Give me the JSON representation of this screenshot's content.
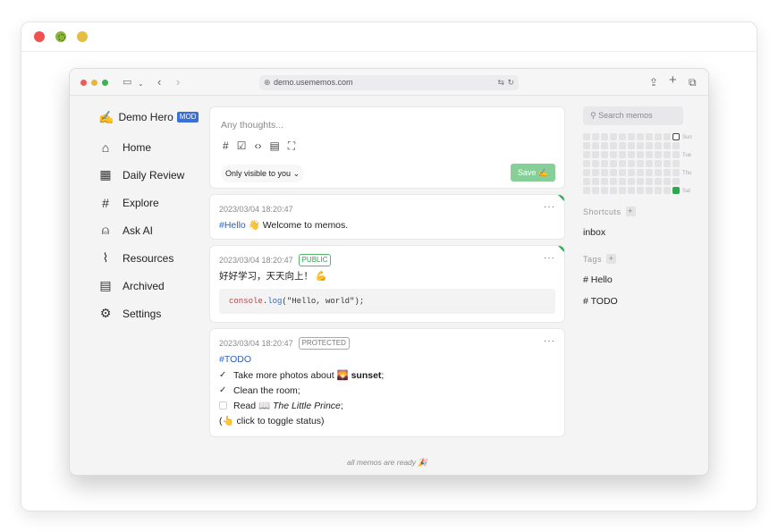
{
  "browser": {
    "url": "demo.usememos.com"
  },
  "sidebar": {
    "brand_emoji": "✍️",
    "brand_name": "Demo Hero",
    "badge": "MOD",
    "items": [
      {
        "label": "Home",
        "icon": "home-icon"
      },
      {
        "label": "Daily Review",
        "icon": "calendar-icon"
      },
      {
        "label": "Explore",
        "icon": "hash-icon"
      },
      {
        "label": "Ask AI",
        "icon": "bot-icon"
      },
      {
        "label": "Resources",
        "icon": "paperclip-icon"
      },
      {
        "label": "Archived",
        "icon": "archive-icon"
      },
      {
        "label": "Settings",
        "icon": "gear-icon"
      }
    ]
  },
  "editor": {
    "placeholder": "Any thoughts...",
    "visibility": "Only visible to you",
    "save_label": "Save ✍️"
  },
  "memos": [
    {
      "time": "2023/03/04 18:20:47",
      "tag": "#Hello",
      "text": "👋 Welcome to memos."
    },
    {
      "time": "2023/03/04 18:20:47",
      "visibility": "PUBLIC",
      "text": "好好学习，天天向上！ 💪",
      "code_obj": "console",
      "code_fn": "log",
      "code_args": "(\"Hello, world\");"
    },
    {
      "time": "2023/03/04 18:20:47",
      "visibility": "PROTECTED",
      "tag": "#TODO",
      "todo1": "Take more photos about 🌄 ",
      "todo1_bold": "sunset",
      "todo1_end": ";",
      "todo2": "Clean the room;",
      "todo3": "Read 📖 ",
      "todo3_italic": "The Little Prince",
      "todo3_end": ";",
      "hint": "(👆 click to toggle status)"
    }
  ],
  "footer": "all memos are ready 🎉",
  "right": {
    "search_placeholder": "Search memos",
    "days": [
      "Sun",
      "Tue",
      "Thu",
      "Sat"
    ],
    "shortcuts_label": "Shortcuts",
    "shortcuts": [
      "inbox"
    ],
    "tags_label": "Tags",
    "tags": [
      "# Hello",
      "# TODO"
    ],
    "colors": {
      "accent": "#2fa84f",
      "save": "#86cf98",
      "link": "#2f5fb8"
    }
  }
}
